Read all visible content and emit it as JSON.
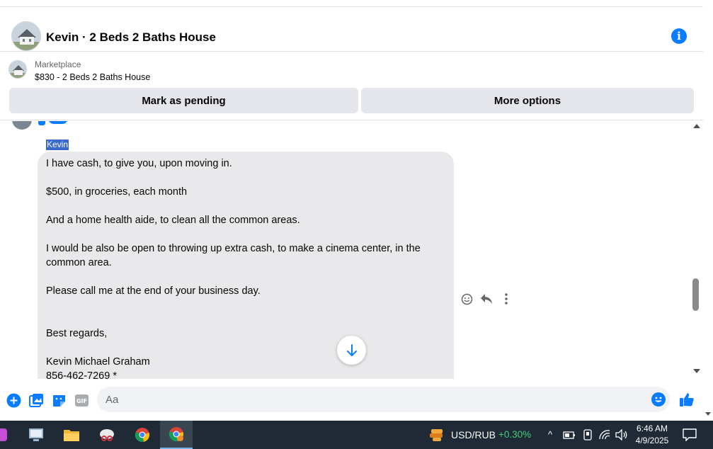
{
  "header": {
    "title": "Kevin · 2 Beds 2 Baths House",
    "info_icon": "i"
  },
  "listing": {
    "source": "Marketplace",
    "name": "$830 - 2 Beds 2 Baths House",
    "buttons": {
      "mark_pending": "Mark as pending",
      "more_options": "More options"
    }
  },
  "message": {
    "sender": "Kevin",
    "lines": [
      "I have cash, to give you, upon moving in.",
      "$500, in groceries, each month",
      "And a home health aide, to clean all the common areas.",
      "I would be also be open to throwing up extra cash, to make a cinema center, in the",
      "common area.",
      "Please call me at the end of your business day.",
      "Best regards,",
      "Kevin Michael Graham",
      "856-462-7269 *"
    ]
  },
  "composer": {
    "placeholder": "Aa"
  },
  "taskbar": {
    "ticker": "USD/RUB",
    "change": "+0.30%",
    "time": "6:46 AM",
    "date": "4/9/2025"
  },
  "colors": {
    "accent": "#0a7cff",
    "bubble": "#e9e9eb",
    "button": "#e4e6eb",
    "positive": "#3fd07e",
    "taskbar": "#1f2a36"
  }
}
